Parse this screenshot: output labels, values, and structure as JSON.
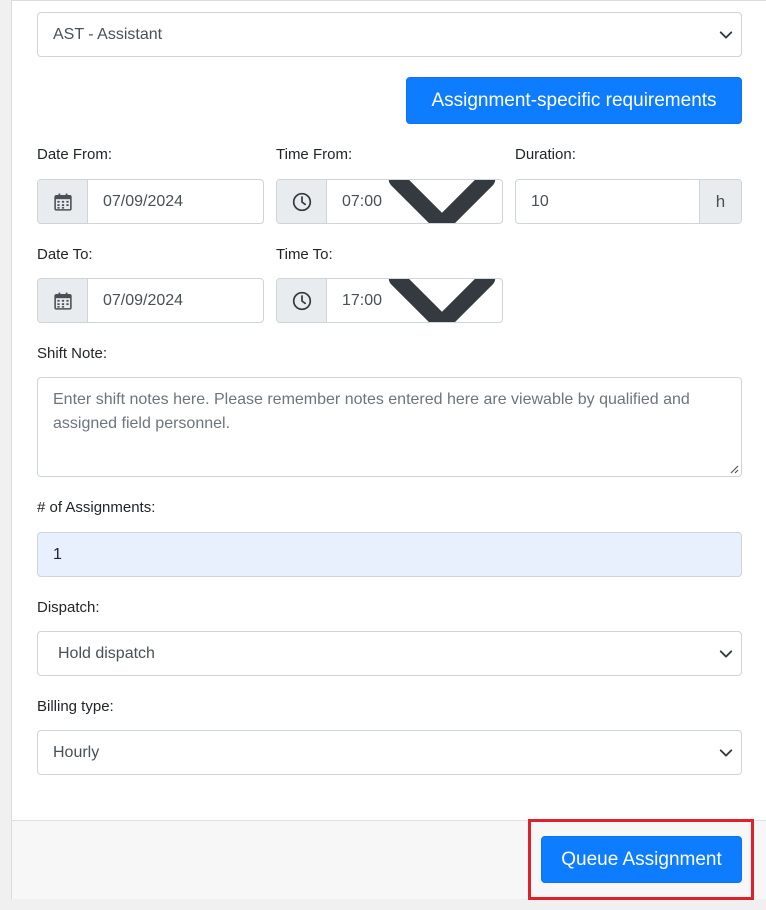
{
  "role_select": {
    "value": "AST - Assistant"
  },
  "requirements_button": {
    "label": "Assignment-specific requirements"
  },
  "date_from": {
    "label": "Date From:",
    "value": "07/09/2024"
  },
  "time_from": {
    "label": "Time From:",
    "value": "07:00"
  },
  "duration": {
    "label": "Duration:",
    "value": "10",
    "unit": "h"
  },
  "date_to": {
    "label": "Date To:",
    "value": "07/09/2024"
  },
  "time_to": {
    "label": "Time To:",
    "value": "17:00"
  },
  "shift_note": {
    "label": "Shift Note:",
    "placeholder": "Enter shift notes here. Please remember notes entered here are viewable by qualified and assigned field personnel."
  },
  "assignments": {
    "label": "# of Assignments:",
    "value": "1"
  },
  "dispatch": {
    "label": "Dispatch:",
    "value": "Hold dispatch"
  },
  "billing": {
    "label": "Billing type:",
    "value": "Hourly"
  },
  "footer": {
    "queue_label": "Queue Assignment"
  },
  "colors": {
    "primary": "#0d7cff",
    "highlight": "#e0202a",
    "input_highlight": "#e8f0fe"
  }
}
